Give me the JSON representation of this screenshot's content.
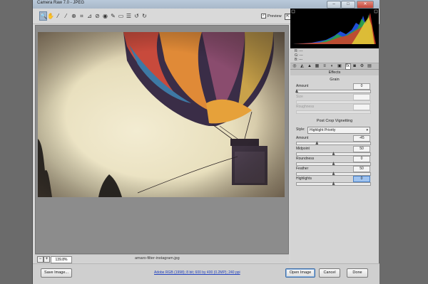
{
  "window": {
    "title": "Camera Raw 7.0  -  JPEG",
    "minimize": "–",
    "maximize": "□",
    "close": "✕"
  },
  "toolbar": {
    "tools": [
      {
        "name": "zoom-tool-icon",
        "glyph": "🔍",
        "selected": true
      },
      {
        "name": "hand-tool-icon",
        "glyph": "✋",
        "selected": false
      },
      {
        "name": "white-balance-tool-icon",
        "glyph": "⁄",
        "selected": false
      },
      {
        "name": "color-sampler-tool-icon",
        "glyph": "⁄",
        "selected": false
      },
      {
        "name": "targeted-adjustment-tool-icon",
        "glyph": "⊕",
        "selected": false
      },
      {
        "name": "crop-tool-icon",
        "glyph": "⌗",
        "selected": false
      },
      {
        "name": "straighten-tool-icon",
        "glyph": "⊿",
        "selected": false
      },
      {
        "name": "spot-removal-tool-icon",
        "glyph": "⊘",
        "selected": false
      },
      {
        "name": "red-eye-tool-icon",
        "glyph": "◉",
        "selected": false
      },
      {
        "name": "adjustment-brush-icon",
        "glyph": "✎",
        "selected": false
      },
      {
        "name": "graduated-filter-icon",
        "glyph": "▭",
        "selected": false
      },
      {
        "name": "preferences-icon",
        "glyph": "☰",
        "selected": false
      },
      {
        "name": "rotate-left-icon",
        "glyph": "↺",
        "selected": false
      },
      {
        "name": "rotate-right-icon",
        "glyph": "↻",
        "selected": false
      }
    ],
    "preview_label": "Preview",
    "preview_checked": "✓",
    "fullscreen_glyph": "⇱"
  },
  "readout": {
    "r": "R:  ---",
    "g": "G:  ---",
    "b": "B:  ---"
  },
  "panel_tabs": [
    "◎",
    "◭",
    "▲",
    "▦",
    "≡",
    "◐",
    "▣",
    "fx",
    "◙",
    "⚙",
    "▤"
  ],
  "panel_tab_selected": 7,
  "panel": {
    "header": "Effects",
    "grain": {
      "title": "Grain",
      "amount": {
        "label": "Amount",
        "value": "0",
        "level": 0.0
      },
      "size": {
        "label": "Size",
        "value": "",
        "level": 0.0
      },
      "roughness": {
        "label": "Roughness",
        "value": "",
        "level": 0.0
      }
    },
    "vignetting": {
      "title": "Post Crop Vignetting",
      "style_label": "Style:",
      "style_value": "Highlight Priority",
      "amount": {
        "label": "Amount",
        "value": "-45",
        "level": 0.275
      },
      "midpoint": {
        "label": "Midpoint",
        "value": "50",
        "level": 0.5
      },
      "roundness": {
        "label": "Roundness",
        "value": "0",
        "level": 0.5
      },
      "feather": {
        "label": "Feather",
        "value": "50",
        "level": 0.5
      },
      "highlights": {
        "label": "Highlights",
        "value": "0",
        "level": 0.5
      }
    }
  },
  "statusbar": {
    "zoom_minus": "−",
    "zoom_plus": "+",
    "zoom_value": "139.8%",
    "filename": "amaro-filter-instagram.jpg"
  },
  "bottom": {
    "save": "Save Image...",
    "workflow_link": "Adobe RGB (1998); 8 bit; 600 by 400 (0.2MP); 240 ppi",
    "open": "Open Image",
    "cancel": "Cancel",
    "done": "Done"
  }
}
